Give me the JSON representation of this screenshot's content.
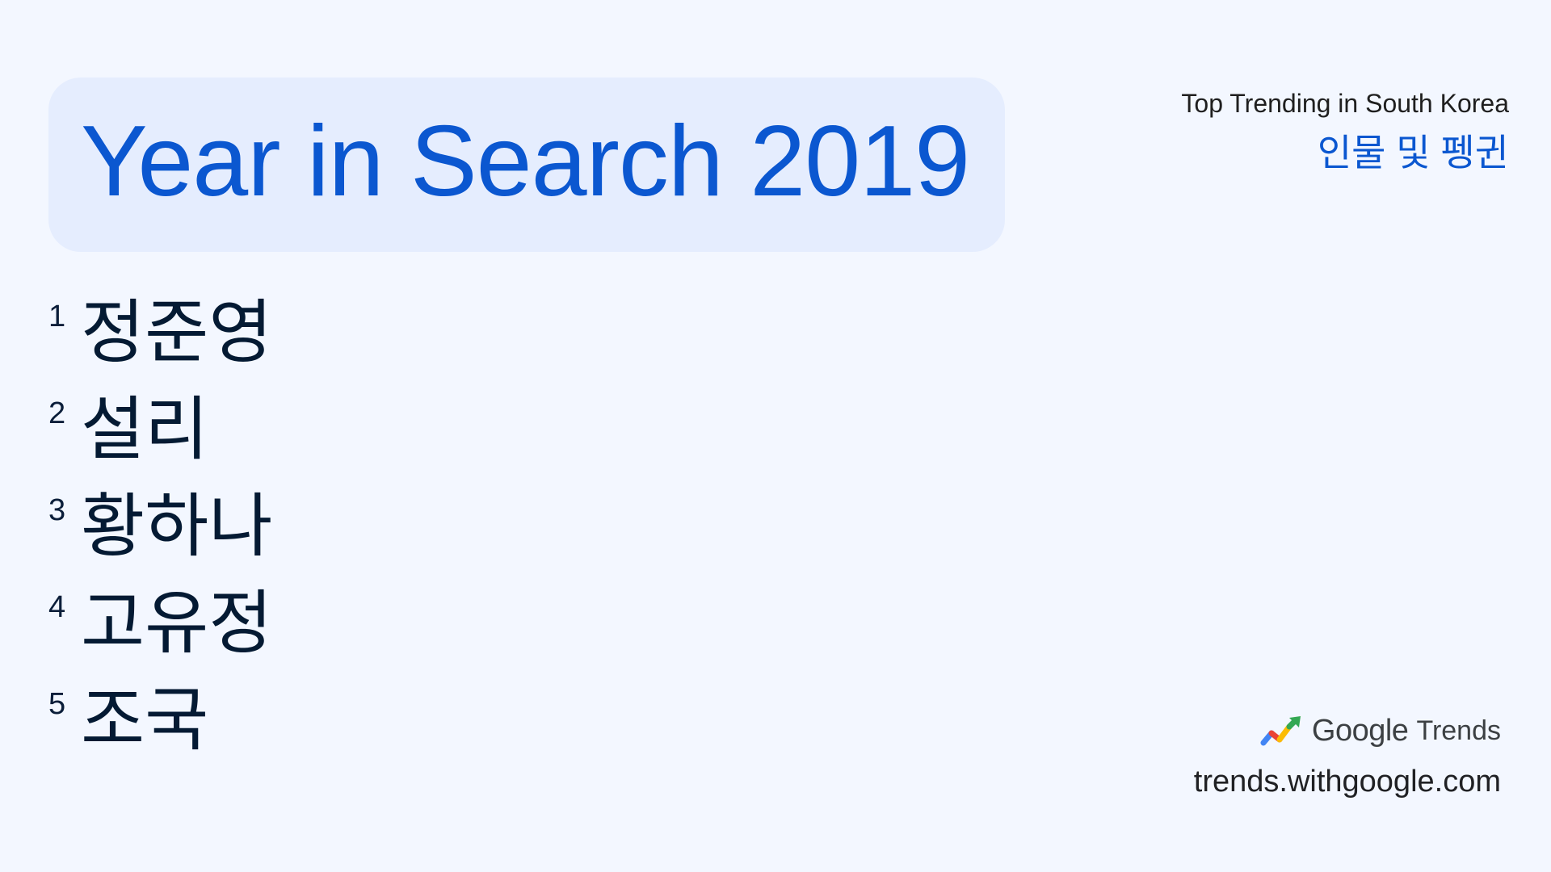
{
  "header": {
    "title": "Year in Search 2019",
    "subtitle": "Top Trending in South Korea",
    "category": "인물 및 펭귄"
  },
  "ranking": [
    {
      "rank": "1",
      "name": "정준영"
    },
    {
      "rank": "2",
      "name": "설리"
    },
    {
      "rank": "3",
      "name": "황하나"
    },
    {
      "rank": "4",
      "name": "고유정"
    },
    {
      "rank": "5",
      "name": "조국"
    }
  ],
  "footer": {
    "brand_google": "Google",
    "brand_trends": "Trends",
    "url": "trends.withgoogle.com",
    "icon": "google-trends-logo-icon"
  },
  "colors": {
    "background": "#f3f7ff",
    "card": "#e5edfe",
    "accent": "#0b57d0",
    "text": "#041a33"
  }
}
